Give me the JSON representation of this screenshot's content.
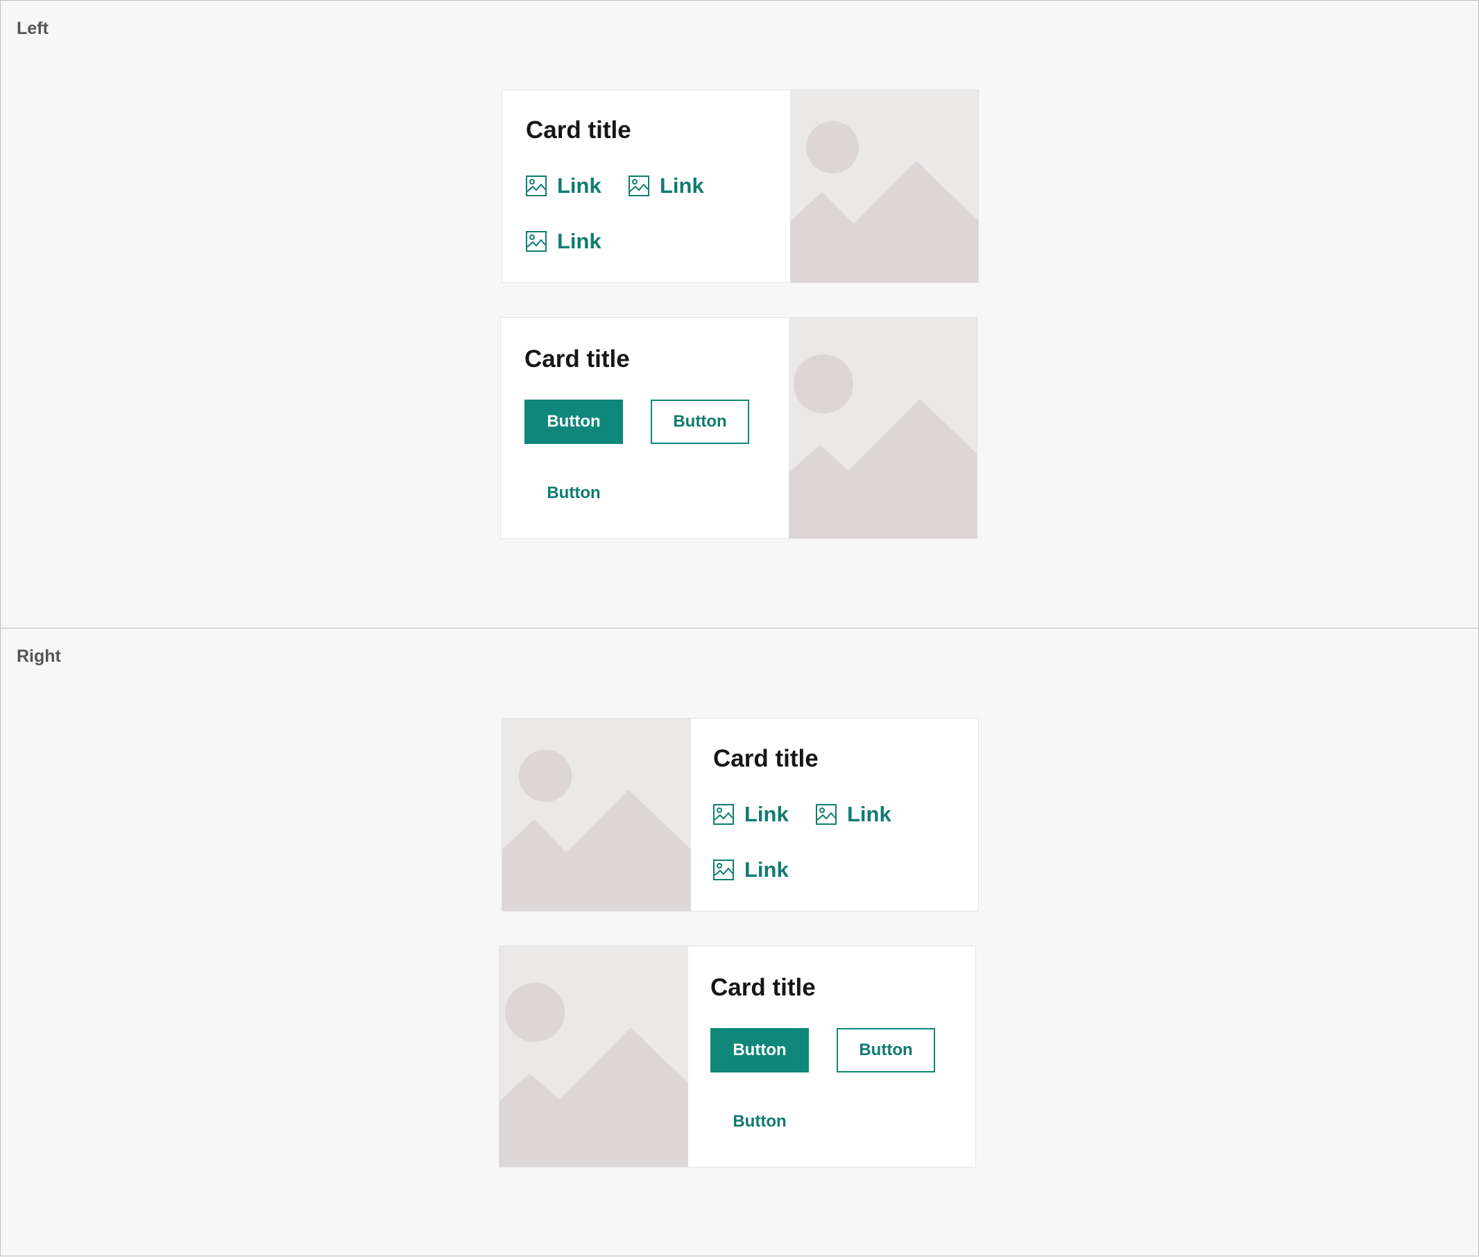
{
  "sections": [
    {
      "label": "Left",
      "cards": [
        {
          "title": "Card title",
          "links": [
            "Link",
            "Link",
            "Link"
          ]
        },
        {
          "title": "Card title",
          "buttons": {
            "primary": "Button",
            "secondary": "Button",
            "tertiary": "Button"
          }
        }
      ]
    },
    {
      "label": "Right",
      "cards": [
        {
          "title": "Card title",
          "links": [
            "Link",
            "Link",
            "Link"
          ]
        },
        {
          "title": "Card title",
          "buttons": {
            "primary": "Button",
            "secondary": "Button",
            "tertiary": "Button"
          }
        }
      ]
    }
  ],
  "colors": {
    "accent": "#0f877a",
    "link": "#0f7c70",
    "placeholder_bg": "#ebe8e8",
    "placeholder_shape": "#dcd6d7"
  },
  "icons": [
    "image-icon",
    "image-placeholder"
  ]
}
